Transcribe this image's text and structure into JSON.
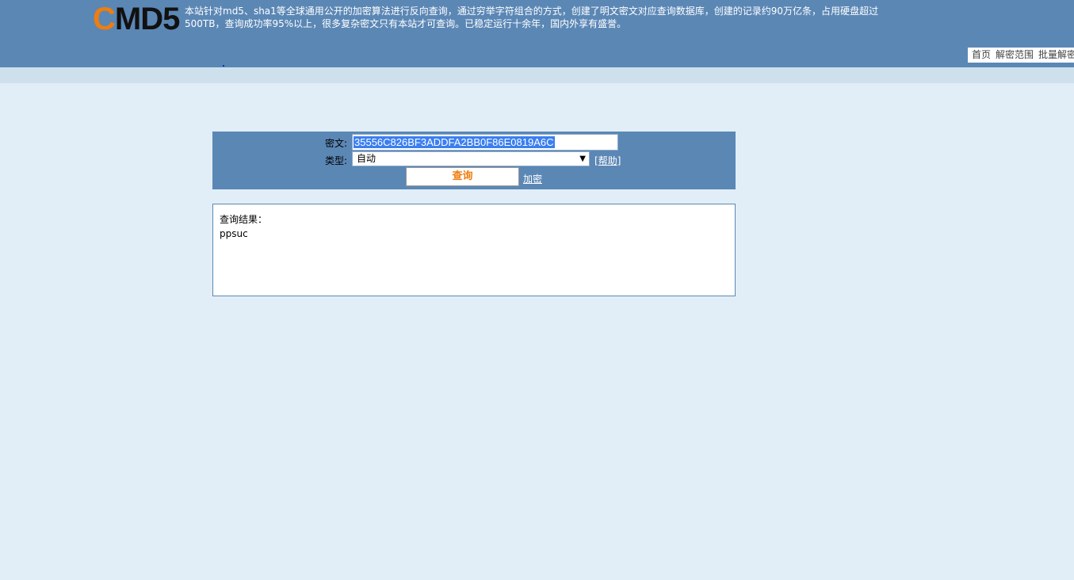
{
  "header": {
    "logo_c": "C",
    "logo_rest": "MD5",
    "intro": "本站针对md5、sha1等全球通用公开的加密算法进行反向查询，通过穷举字符组合的方式，创建了明文密文对应查询数据库，创建的记录约90万亿条，占用硬盘超过500TB，查询成功率95%以上，很多复杂密文只有本站才可查询。已稳定运行十余年，国内外享有盛誉。"
  },
  "nav": {
    "items": [
      "首页",
      "解密范围",
      "批量解密"
    ]
  },
  "form": {
    "cipher_label": "密文:",
    "cipher_value": "35556C826BF3ADDFA2BB0F86E0819A6C",
    "type_label": "类型:",
    "type_value": "自动",
    "help_open": "[",
    "help_label": "帮助",
    "help_close": "]",
    "query_label": "查询",
    "encrypt_label": "加密"
  },
  "result": {
    "title": "查询结果：",
    "value": "ppsuc"
  },
  "colors": {
    "header_bg": "#5b87b5",
    "page_bg": "#e1eef7",
    "accent": "#ef7d0f"
  }
}
